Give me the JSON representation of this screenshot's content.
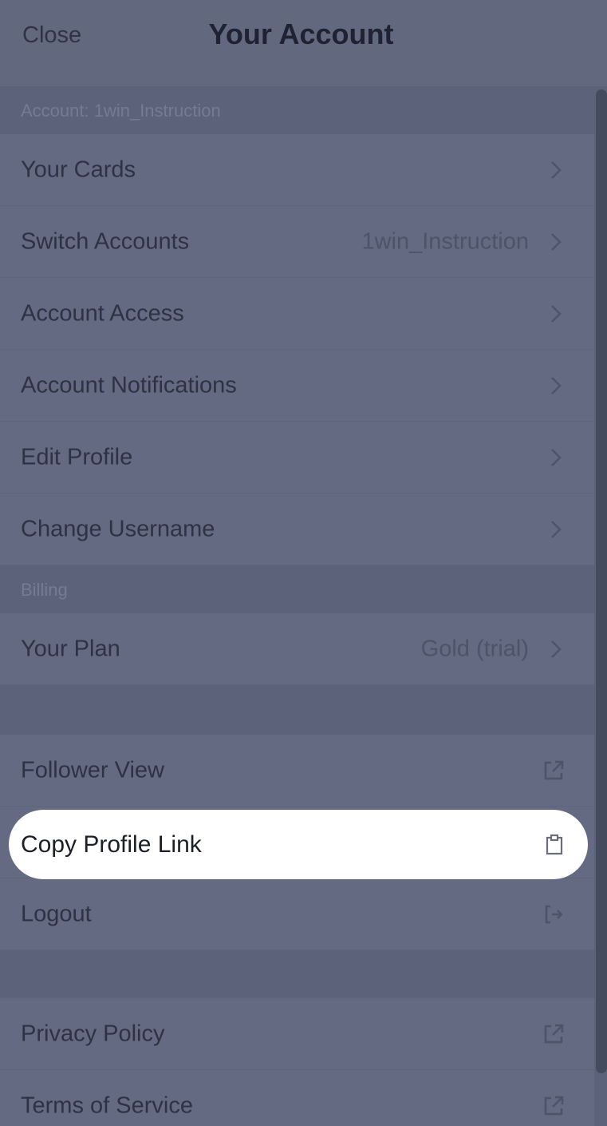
{
  "header": {
    "close_label": "Close",
    "title": "Your Account"
  },
  "sections": {
    "account_header": "Account: 1win_Instruction",
    "billing_header": "Billing"
  },
  "account_items": [
    {
      "label": "Your Cards",
      "value": ""
    },
    {
      "label": "Switch Accounts",
      "value": "1win_Instruction"
    },
    {
      "label": "Account Access",
      "value": ""
    },
    {
      "label": "Account Notifications",
      "value": ""
    },
    {
      "label": "Edit Profile",
      "value": ""
    },
    {
      "label": "Change Username",
      "value": ""
    }
  ],
  "billing_items": [
    {
      "label": "Your Plan",
      "value": "Gold (trial)"
    }
  ],
  "action_items": [
    {
      "label": "Follower View",
      "icon": "external-link-icon"
    },
    {
      "label": "Copy Profile Link",
      "icon": "clipboard-icon",
      "highlighted": true
    },
    {
      "label": "Logout",
      "icon": "logout-icon"
    }
  ],
  "legal_items": [
    {
      "label": "Privacy Policy",
      "icon": "external-link-icon"
    },
    {
      "label": "Terms of Service",
      "icon": "external-link-icon"
    }
  ],
  "colors": {
    "overlay": "#636a81",
    "section_bg": "#5b6279",
    "highlight": "#ffffff"
  }
}
